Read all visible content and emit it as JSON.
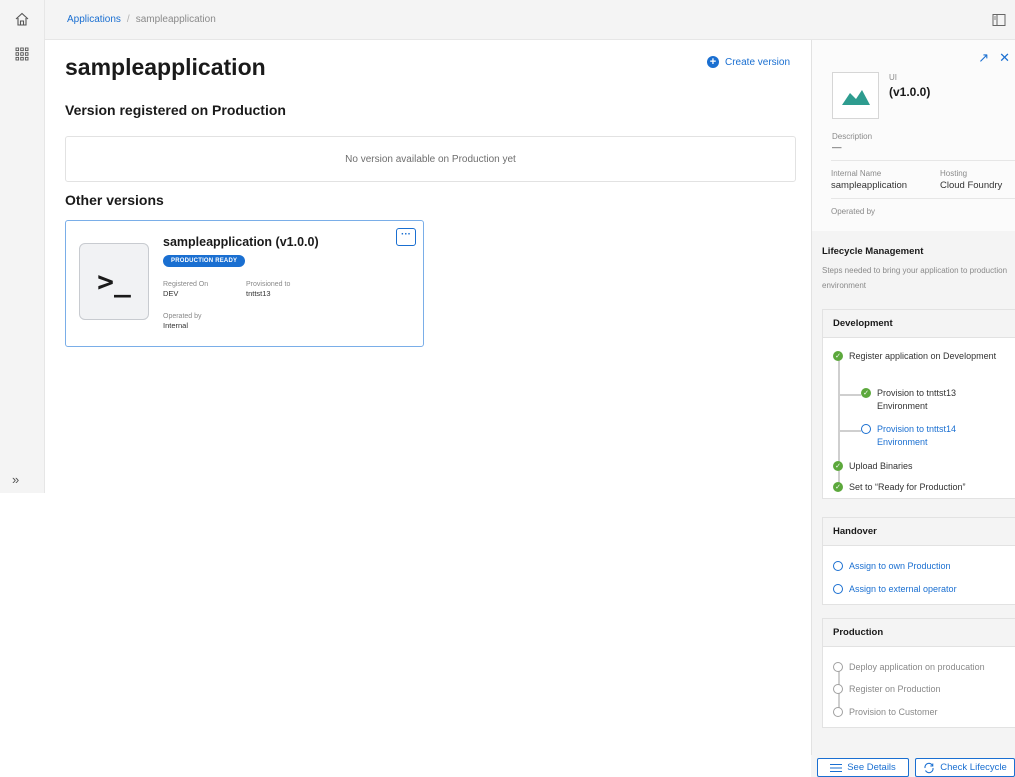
{
  "breadcrumb": {
    "root": "Applications",
    "separator": "/",
    "current": "sampleapplication"
  },
  "main": {
    "title": "sampleapplication",
    "create_version_label": "Create version",
    "production_section": "Version registered on Production",
    "production_empty": "No version available on Production yet",
    "other_section": "Other versions"
  },
  "version_card": {
    "icon_glyph": ">_",
    "title": "sampleapplication (v1.0.0)",
    "badge": "PRODUCTION READY",
    "registered_on_label": "Registered On",
    "registered_on_value": "DEV",
    "provisioned_to_label": "Provisioned to",
    "provisioned_to_value": "tnttst13",
    "operated_by_label": "Operated by",
    "operated_by_value": "Internal",
    "more_label": "···"
  },
  "details_panel": {
    "kind": "UI",
    "version": "(v1.0.0)",
    "description_label": "Description",
    "description_value": "—",
    "internal_name_label": "Internal Name",
    "internal_name_value": "sampleapplication",
    "hosting_label": "Hosting",
    "hosting_value": "Cloud Foundry",
    "operated_by_label": "Operated by",
    "lifecycle_title": "Lifecycle Management",
    "lifecycle_desc": "Steps needed to bring your application to production environment"
  },
  "stages": {
    "development": {
      "title": "Development",
      "steps": [
        "Register application on Development",
        "Provision to tnttst13 Environment",
        "Provision to tnttst14 Environment",
        "Upload Binaries",
        "Set to “Ready for Production”"
      ]
    },
    "handover": {
      "title": "Handover",
      "steps": [
        "Assign to own Production",
        "Assign to external operator"
      ]
    },
    "production": {
      "title": "Production",
      "steps": [
        "Deploy application on producation",
        "Register on Production",
        "Provision to Customer"
      ]
    }
  },
  "footer": {
    "see_details": "See Details",
    "check_lifecycle": "Check Lifecycle"
  },
  "colors": {
    "accent": "#1a6fd1",
    "success": "#5ca83c",
    "brand_teal": "#2e9c8f"
  }
}
